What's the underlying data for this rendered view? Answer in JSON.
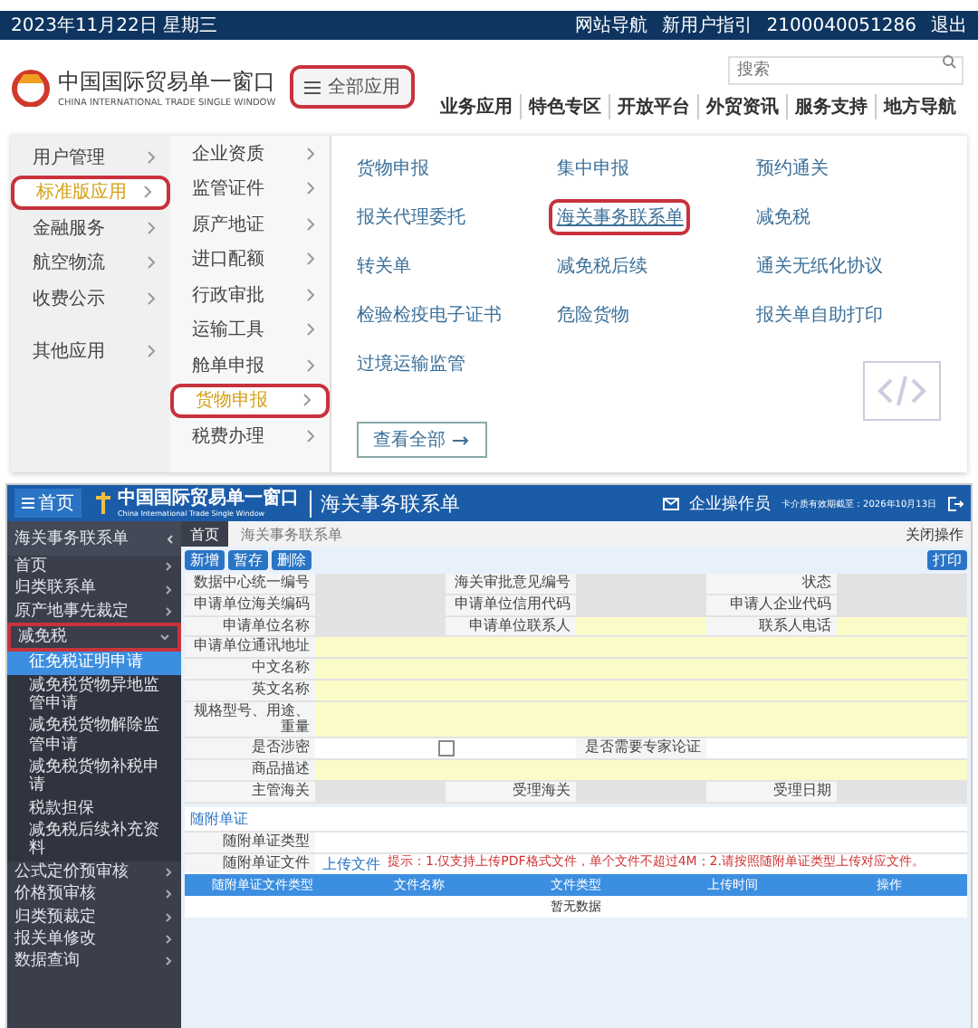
{
  "top_bar": {
    "date": "2023年11月22日 星期三",
    "links": [
      "网站导航",
      "新用户指引"
    ],
    "account": "2100040051286",
    "logout": "退出"
  },
  "header": {
    "logo_title": "中国国际贸易单一窗口",
    "logo_subtitle": "CHINA INTERNATIONAL TRADE SINGLE WINDOW",
    "all_apps": {
      "label": "全部应用",
      "circled": true
    },
    "search": {
      "placeholder": "搜索"
    },
    "nav": [
      "业务应用",
      "特色专区",
      "开放平台",
      "外贸资讯",
      "服务支持",
      "地方导航"
    ]
  },
  "mega_menu": {
    "categories": [
      {
        "label": "用户管理",
        "selected": false
      },
      {
        "label": "标准版应用",
        "selected": true
      },
      {
        "label": "金融服务",
        "selected": false
      },
      {
        "label": "航空物流",
        "selected": false
      },
      {
        "label": "收费公示",
        "selected": false
      },
      {
        "label": "其他应用",
        "selected": false
      }
    ],
    "subcategories": [
      {
        "label": "企业资质",
        "selected": false
      },
      {
        "label": "监管证件",
        "selected": false
      },
      {
        "label": "原产地证",
        "selected": false
      },
      {
        "label": "进口配额",
        "selected": false
      },
      {
        "label": "行政审批",
        "selected": false
      },
      {
        "label": "运输工具",
        "selected": false
      },
      {
        "label": "舱单申报",
        "selected": false
      },
      {
        "label": "货物申报",
        "selected": true
      },
      {
        "label": "税费办理",
        "selected": false
      }
    ],
    "apps": [
      {
        "label": "货物申报",
        "circled": false
      },
      {
        "label": "集中申报",
        "circled": false
      },
      {
        "label": "预约通关",
        "circled": false
      },
      {
        "label": "报关代理委托",
        "circled": false
      },
      {
        "label": "海关事务联系单",
        "circled": true
      },
      {
        "label": "减免税",
        "circled": false
      },
      {
        "label": "转关单",
        "circled": false
      },
      {
        "label": "减免税后续",
        "circled": false
      },
      {
        "label": "通关无纸化协议",
        "circled": false
      },
      {
        "label": "检验检疫电子证书",
        "circled": false
      },
      {
        "label": "危险货物",
        "circled": false
      },
      {
        "label": "报关单自助打印",
        "circled": false
      },
      {
        "label": "过境运输监管",
        "circled": false
      }
    ],
    "view_all": "查看全部"
  },
  "app": {
    "home_button": "首页",
    "logo_title": "中国国际贸易单一窗口",
    "logo_subtitle": "China International Trade Single Window",
    "page_title": "海关事务联系单",
    "user": "企业操作员",
    "card_expiry": "卡介质有效期截至：2026年10月13日",
    "tabs": [
      {
        "label": "首页",
        "selected": true
      },
      {
        "label": "海关事务联系单",
        "selected": false
      }
    ],
    "close_menu": "关闭操作",
    "toolbar": [
      "新增",
      "暂存",
      "删除"
    ],
    "print_button": "打印",
    "sidebar": {
      "title": "海关事务联系单",
      "items": [
        {
          "label": "首页",
          "selected": false,
          "circled": false
        },
        {
          "label": "归类联系单",
          "selected": false,
          "circled": false
        },
        {
          "label": "原产地事先裁定",
          "selected": false,
          "circled": false
        },
        {
          "label": "减免税",
          "selected": false,
          "circled": true,
          "expanded": true,
          "children": [
            {
              "label": "征免税证明申请",
              "selected": true,
              "circled": false
            },
            {
              "label": "减免税货物异地监管申请",
              "selected": false,
              "circled": false
            },
            {
              "label": "减免税货物解除监管申请",
              "selected": false,
              "circled": false
            },
            {
              "label": "减免税货物补税申请",
              "selected": false,
              "circled": false
            },
            {
              "label": "税款担保",
              "selected": false,
              "circled": false
            },
            {
              "label": "减免税后续补充资料",
              "selected": false,
              "circled": false
            }
          ]
        },
        {
          "label": "公式定价预审核",
          "selected": false,
          "circled": false
        },
        {
          "label": "价格预审核",
          "selected": false,
          "circled": false
        },
        {
          "label": "归类预裁定",
          "selected": false,
          "circled": false
        },
        {
          "label": "报关单修改",
          "selected": false,
          "circled": false
        },
        {
          "label": "数据查询",
          "selected": false,
          "circled": false
        }
      ]
    },
    "form_rows": [
      {
        "cells": [
          {
            "kind": "label",
            "text": "数据中心统一编号"
          },
          {
            "kind": "value",
            "editable": false
          },
          {
            "kind": "label",
            "text": "海关审批意见编号"
          },
          {
            "kind": "value",
            "editable": false
          },
          {
            "kind": "label",
            "text": "状态"
          },
          {
            "kind": "value",
            "editable": false
          }
        ]
      },
      {
        "cells": [
          {
            "kind": "label",
            "text": "申请单位海关编码"
          },
          {
            "kind": "value",
            "editable": false
          },
          {
            "kind": "label",
            "text": "申请单位信用代码"
          },
          {
            "kind": "value",
            "editable": false
          },
          {
            "kind": "label",
            "text": "申请人企业代码"
          },
          {
            "kind": "value",
            "editable": false
          }
        ]
      },
      {
        "cells": [
          {
            "kind": "label",
            "text": "申请单位名称"
          },
          {
            "kind": "value",
            "editable": false
          },
          {
            "kind": "label",
            "text": "申请单位联系人"
          },
          {
            "kind": "value",
            "editable": true,
            "required": true
          },
          {
            "kind": "label",
            "text": "联系人电话"
          },
          {
            "kind": "value",
            "editable": true,
            "required": true
          }
        ]
      },
      {
        "cells": [
          {
            "kind": "label",
            "text": "申请单位通讯地址"
          },
          {
            "kind": "value",
            "editable": true,
            "required": true
          }
        ]
      },
      {
        "cells": [
          {
            "kind": "label",
            "text": "中文名称"
          },
          {
            "kind": "value",
            "editable": true,
            "required": true
          }
        ]
      },
      {
        "cells": [
          {
            "kind": "label",
            "text": "英文名称"
          },
          {
            "kind": "value",
            "editable": true,
            "required": true
          }
        ]
      },
      {
        "cells": [
          {
            "kind": "label",
            "text": "规格型号、用途、重量"
          },
          {
            "kind": "value",
            "editable": true,
            "required": true
          }
        ]
      },
      {
        "cells": [
          {
            "kind": "label",
            "text": "是否涉密"
          },
          {
            "kind": "checkbox",
            "checked": false
          },
          {
            "kind": "label",
            "text": "是否需要专家论证"
          },
          {
            "kind": "value",
            "editable": true,
            "required": false
          }
        ]
      },
      {
        "cells": [
          {
            "kind": "label",
            "text": "商品描述"
          },
          {
            "kind": "value",
            "editable": true,
            "required": true
          }
        ]
      },
      {
        "cells": [
          {
            "kind": "label",
            "text": "主管海关"
          },
          {
            "kind": "value",
            "editable": false
          },
          {
            "kind": "label",
            "text": "受理海关"
          },
          {
            "kind": "value",
            "editable": false
          },
          {
            "kind": "label",
            "text": "受理日期"
          },
          {
            "kind": "value",
            "editable": false
          }
        ]
      }
    ],
    "attachments": {
      "title": "随附单证",
      "type_label": "随附单证类型",
      "file_label": "随附单证文件",
      "upload": "上传文件",
      "notes": "提示：1.仅支持上传PDF格式文件，单个文件不超过4M；2.请按照随附单证类型上传对应文件。"
    },
    "table": {
      "columns": [
        "随附单证文件类型",
        "文件名称",
        "文件类型",
        "上传时间",
        "操作"
      ],
      "empty": "暂无数据"
    }
  }
}
